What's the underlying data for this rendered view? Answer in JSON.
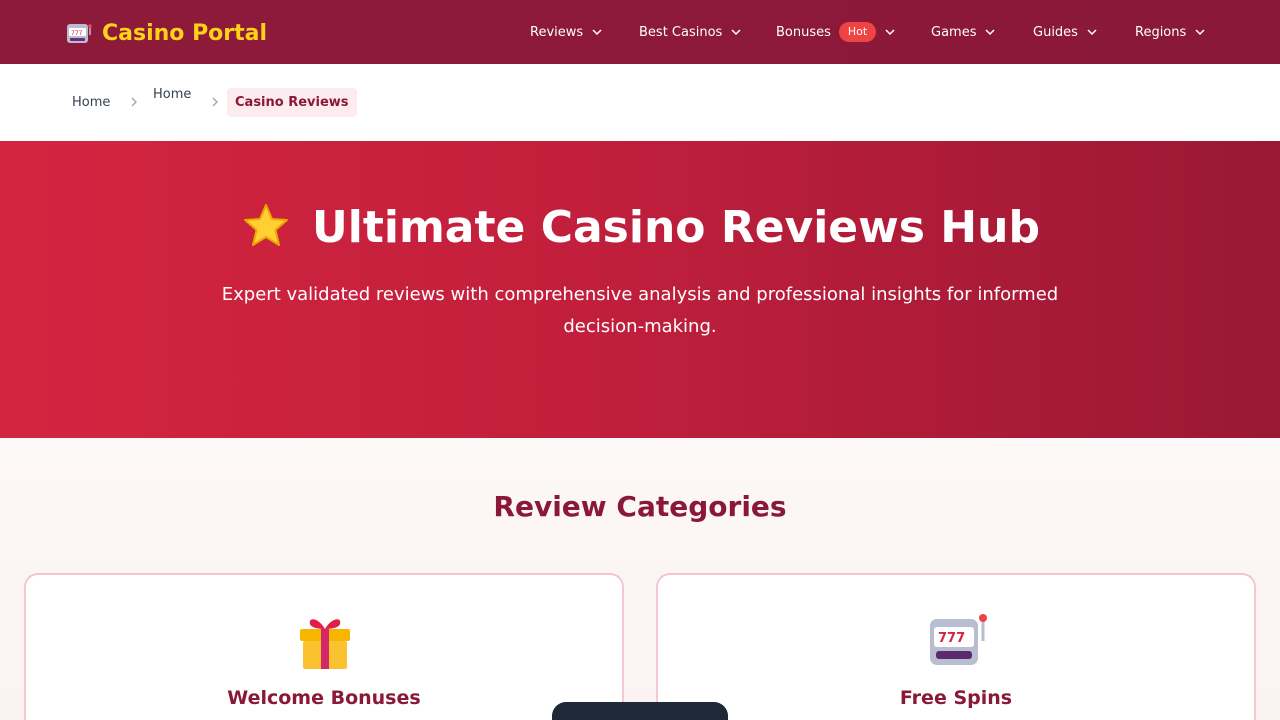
{
  "header": {
    "logo_text": "Casino Portal",
    "logo_icon": "slot-machine-icon",
    "nav": [
      {
        "label": "Reviews"
      },
      {
        "label": "Best Casinos"
      },
      {
        "label": "Bonuses",
        "badge": "Hot"
      },
      {
        "label": "Games"
      },
      {
        "label": "Guides"
      },
      {
        "label": "Regions"
      }
    ]
  },
  "breadcrumb": {
    "items": [
      "Home",
      "Home"
    ],
    "current": "Casino Reviews"
  },
  "hero": {
    "icon": "star-icon",
    "title": "Ultimate Casino Reviews Hub",
    "subtitle": "Expert validated reviews with comprehensive analysis and professional insights for informed decision-making."
  },
  "categories": {
    "title": "Review Categories",
    "cards": [
      {
        "title": "Welcome Bonuses",
        "icon": "gift-icon"
      },
      {
        "title": "Free Spins",
        "icon": "slot-machine-icon"
      }
    ]
  },
  "colors": {
    "header_bg": "#8e1a3a",
    "logo": "#ffd21a",
    "hero_start": "#d42540",
    "hero_end": "#9a1834",
    "accent": "#8a1838",
    "hot_badge": "#ef4444"
  }
}
